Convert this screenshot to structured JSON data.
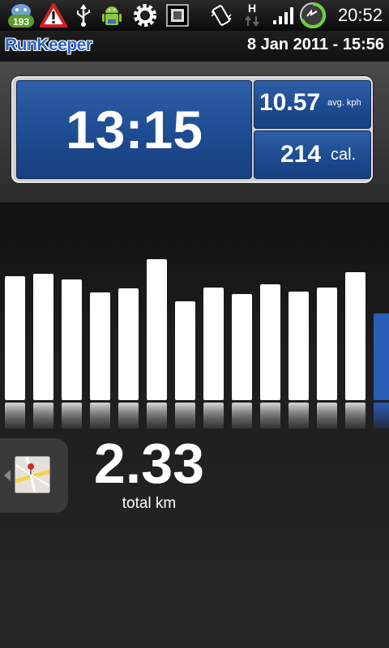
{
  "status_bar": {
    "notification_count": "193",
    "network_type": "H",
    "clock": "20:52",
    "icons": [
      "notification-badge-icon",
      "warning-icon",
      "usb-icon",
      "android-debug-icon",
      "settings-icon",
      "chip-icon",
      "vibrate-icon",
      "hspa-data-icon",
      "signal-icon",
      "battery-icon"
    ]
  },
  "header": {
    "app_name": "RunKeeper",
    "datetime": "8 Jan 2011 - 15:56"
  },
  "stats": {
    "time": "13:15",
    "avg_speed": "10.57",
    "avg_speed_unit": "avg. kph",
    "calories": "214",
    "calories_unit": "cal."
  },
  "chart_data": {
    "type": "bar",
    "title": "",
    "values": [
      153,
      156,
      149,
      133,
      138,
      174,
      122,
      139,
      131,
      143,
      134,
      139,
      158,
      107
    ],
    "highlighted_index": 13,
    "colors": {
      "bar": "#ffffff",
      "highlight": "#2a5db8"
    }
  },
  "summary": {
    "distance": "2.33",
    "distance_unit": "total km"
  },
  "icons": {
    "map": "map-thumbnail-icon",
    "arrow": "left-arrow-icon"
  }
}
